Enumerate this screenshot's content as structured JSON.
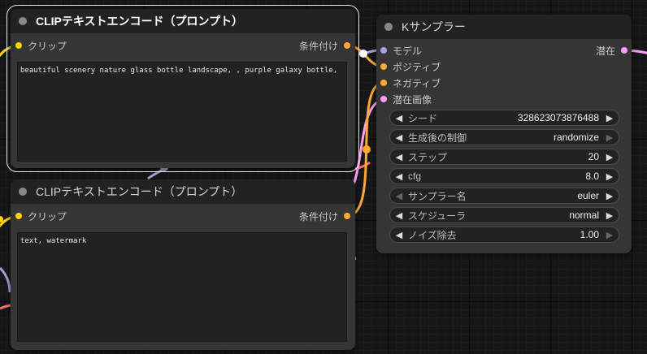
{
  "colors": {
    "clip": "#ffd500",
    "conditioning": "#ffa931",
    "latent": "#ff9cf9",
    "model": "#b39ddb",
    "vae": "#ff6e6e"
  },
  "clip_positive": {
    "title": "CLIPテキストエンコード（プロンプト）",
    "input_clip": "クリップ",
    "output_conditioning": "条件付け",
    "text": "beautiful scenery nature glass bottle landscape, , purple galaxy bottle,"
  },
  "clip_negative": {
    "title": "CLIPテキストエンコード（プロンプト）",
    "input_clip": "クリップ",
    "output_conditioning": "条件付け",
    "text": "text, watermark"
  },
  "ksampler": {
    "title": "Kサンプラー",
    "inputs": {
      "model": "モデル",
      "positive": "ポジティブ",
      "negative": "ネガティブ",
      "latent_image": "潜在画像"
    },
    "output_latent": "潜在",
    "widgets": {
      "seed": {
        "label": "シード",
        "value": "328623073876488"
      },
      "control_after_generate": {
        "label": "生成後の制御",
        "value": "randomize"
      },
      "steps": {
        "label": "ステップ",
        "value": "20"
      },
      "cfg": {
        "label": "cfg",
        "value": "8.0"
      },
      "sampler_name": {
        "label": "サンプラー名",
        "value": "euler"
      },
      "scheduler": {
        "label": "スケジューラ",
        "value": "normal"
      },
      "denoise": {
        "label": "ノイズ除去",
        "value": "1.00"
      }
    }
  }
}
